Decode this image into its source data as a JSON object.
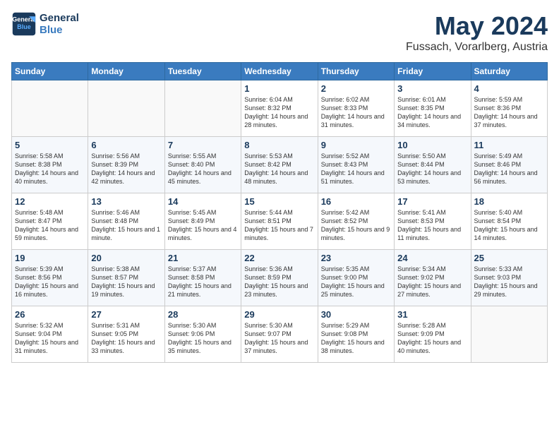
{
  "header": {
    "logo_line1": "General",
    "logo_line2": "Blue",
    "month": "May 2024",
    "location": "Fussach, Vorarlberg, Austria"
  },
  "days_of_week": [
    "Sunday",
    "Monday",
    "Tuesday",
    "Wednesday",
    "Thursday",
    "Friday",
    "Saturday"
  ],
  "weeks": [
    [
      {
        "day": null
      },
      {
        "day": null
      },
      {
        "day": null
      },
      {
        "day": "1",
        "sunrise": "6:04 AM",
        "sunset": "8:32 PM",
        "daylight": "14 hours and 28 minutes."
      },
      {
        "day": "2",
        "sunrise": "6:02 AM",
        "sunset": "8:33 PM",
        "daylight": "14 hours and 31 minutes."
      },
      {
        "day": "3",
        "sunrise": "6:01 AM",
        "sunset": "8:35 PM",
        "daylight": "14 hours and 34 minutes."
      },
      {
        "day": "4",
        "sunrise": "5:59 AM",
        "sunset": "8:36 PM",
        "daylight": "14 hours and 37 minutes."
      }
    ],
    [
      {
        "day": "5",
        "sunrise": "5:58 AM",
        "sunset": "8:38 PM",
        "daylight": "14 hours and 40 minutes."
      },
      {
        "day": "6",
        "sunrise": "5:56 AM",
        "sunset": "8:39 PM",
        "daylight": "14 hours and 42 minutes."
      },
      {
        "day": "7",
        "sunrise": "5:55 AM",
        "sunset": "8:40 PM",
        "daylight": "14 hours and 45 minutes."
      },
      {
        "day": "8",
        "sunrise": "5:53 AM",
        "sunset": "8:42 PM",
        "daylight": "14 hours and 48 minutes."
      },
      {
        "day": "9",
        "sunrise": "5:52 AM",
        "sunset": "8:43 PM",
        "daylight": "14 hours and 51 minutes."
      },
      {
        "day": "10",
        "sunrise": "5:50 AM",
        "sunset": "8:44 PM",
        "daylight": "14 hours and 53 minutes."
      },
      {
        "day": "11",
        "sunrise": "5:49 AM",
        "sunset": "8:46 PM",
        "daylight": "14 hours and 56 minutes."
      }
    ],
    [
      {
        "day": "12",
        "sunrise": "5:48 AM",
        "sunset": "8:47 PM",
        "daylight": "14 hours and 59 minutes."
      },
      {
        "day": "13",
        "sunrise": "5:46 AM",
        "sunset": "8:48 PM",
        "daylight": "15 hours and 1 minute."
      },
      {
        "day": "14",
        "sunrise": "5:45 AM",
        "sunset": "8:49 PM",
        "daylight": "15 hours and 4 minutes."
      },
      {
        "day": "15",
        "sunrise": "5:44 AM",
        "sunset": "8:51 PM",
        "daylight": "15 hours and 7 minutes."
      },
      {
        "day": "16",
        "sunrise": "5:42 AM",
        "sunset": "8:52 PM",
        "daylight": "15 hours and 9 minutes."
      },
      {
        "day": "17",
        "sunrise": "5:41 AM",
        "sunset": "8:53 PM",
        "daylight": "15 hours and 11 minutes."
      },
      {
        "day": "18",
        "sunrise": "5:40 AM",
        "sunset": "8:54 PM",
        "daylight": "15 hours and 14 minutes."
      }
    ],
    [
      {
        "day": "19",
        "sunrise": "5:39 AM",
        "sunset": "8:56 PM",
        "daylight": "15 hours and 16 minutes."
      },
      {
        "day": "20",
        "sunrise": "5:38 AM",
        "sunset": "8:57 PM",
        "daylight": "15 hours and 19 minutes."
      },
      {
        "day": "21",
        "sunrise": "5:37 AM",
        "sunset": "8:58 PM",
        "daylight": "15 hours and 21 minutes."
      },
      {
        "day": "22",
        "sunrise": "5:36 AM",
        "sunset": "8:59 PM",
        "daylight": "15 hours and 23 minutes."
      },
      {
        "day": "23",
        "sunrise": "5:35 AM",
        "sunset": "9:00 PM",
        "daylight": "15 hours and 25 minutes."
      },
      {
        "day": "24",
        "sunrise": "5:34 AM",
        "sunset": "9:02 PM",
        "daylight": "15 hours and 27 minutes."
      },
      {
        "day": "25",
        "sunrise": "5:33 AM",
        "sunset": "9:03 PM",
        "daylight": "15 hours and 29 minutes."
      }
    ],
    [
      {
        "day": "26",
        "sunrise": "5:32 AM",
        "sunset": "9:04 PM",
        "daylight": "15 hours and 31 minutes."
      },
      {
        "day": "27",
        "sunrise": "5:31 AM",
        "sunset": "9:05 PM",
        "daylight": "15 hours and 33 minutes."
      },
      {
        "day": "28",
        "sunrise": "5:30 AM",
        "sunset": "9:06 PM",
        "daylight": "15 hours and 35 minutes."
      },
      {
        "day": "29",
        "sunrise": "5:30 AM",
        "sunset": "9:07 PM",
        "daylight": "15 hours and 37 minutes."
      },
      {
        "day": "30",
        "sunrise": "5:29 AM",
        "sunset": "9:08 PM",
        "daylight": "15 hours and 38 minutes."
      },
      {
        "day": "31",
        "sunrise": "5:28 AM",
        "sunset": "9:09 PM",
        "daylight": "15 hours and 40 minutes."
      },
      {
        "day": null
      }
    ]
  ]
}
